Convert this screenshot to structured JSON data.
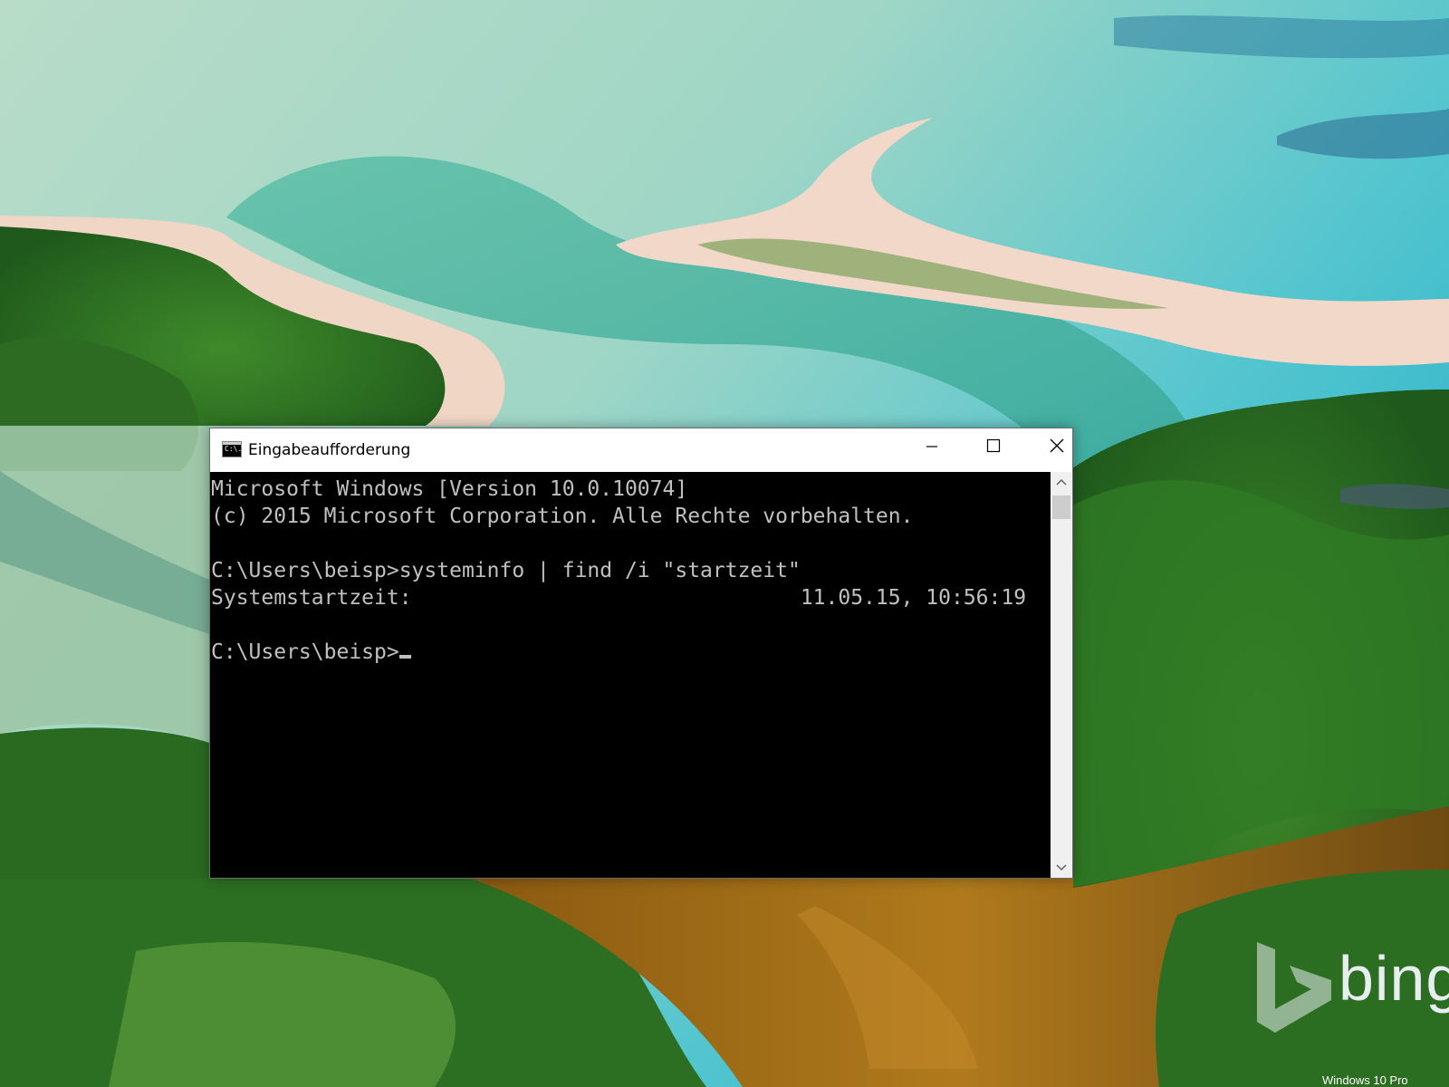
{
  "window": {
    "title": "Eingabeaufforderung",
    "icon": "cmd-icon",
    "icon_text": "C:\\.",
    "controls": [
      "minimize-icon",
      "maximize-icon",
      "close-icon"
    ]
  },
  "console": {
    "lines": [
      "Microsoft Windows [Version 10.0.10074]",
      "(c) 2015 Microsoft Corporation. Alle Rechte vorbehalten.",
      "",
      "C:\\Users\\beisp>systeminfo | find /i \"startzeit\"",
      "Systemstartzeit:                               11.05.15, 10:56:19",
      "",
      "C:\\Users\\beisp>"
    ]
  },
  "desktop": {
    "branding": "bing",
    "watermark": "Windows 10 Pro"
  },
  "colors": {
    "console_bg": "#000000",
    "console_text": "#c0c0c0",
    "titlebar_bg": "#ffffff",
    "scrollbar_bg": "#f0f0f0"
  }
}
